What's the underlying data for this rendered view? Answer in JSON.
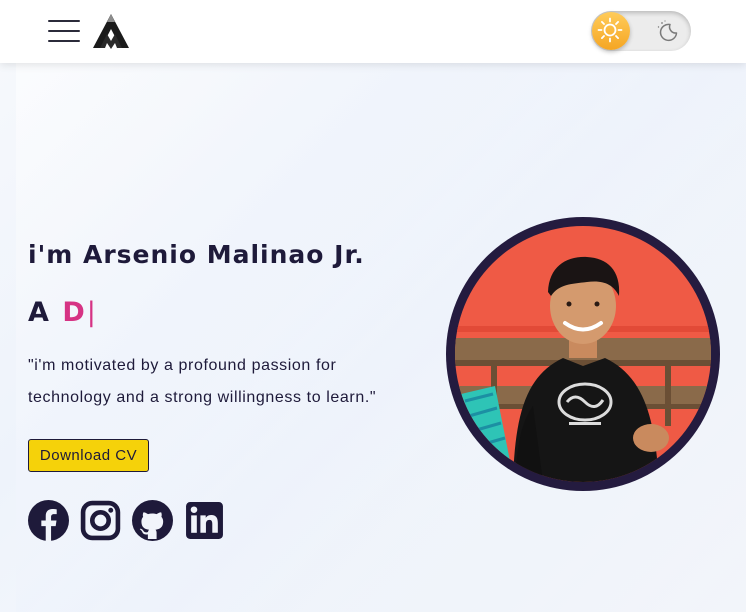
{
  "navbar": {
    "menu_icon": "hamburger-icon",
    "logo_icon": "logo-mountain-icon",
    "theme_toggle": {
      "state": "light",
      "light_icon": "sun-icon",
      "dark_icon": "moon-icon"
    }
  },
  "hero": {
    "greeting": "i'm Arsenio Malinao Jr.",
    "typed_prefix": "A",
    "typed_text": "D",
    "typed_cursor": "|",
    "quote": "\"i'm motivated by a profound passion for technology and a strong willingness to learn.\"",
    "cv_button": "Download CV",
    "profile_photo": "profile-photo"
  },
  "social_links": [
    {
      "name": "facebook-icon"
    },
    {
      "name": "instagram-icon"
    },
    {
      "name": "github-icon"
    },
    {
      "name": "linkedin-icon"
    }
  ],
  "colors": {
    "primary_text": "#1e1a3a",
    "accent_pink": "#d63384",
    "button_yellow": "#f5d20a",
    "avatar_border": "#241b3f",
    "photo_background": "#ef5a45",
    "toggle_knob": "#f5a623"
  }
}
